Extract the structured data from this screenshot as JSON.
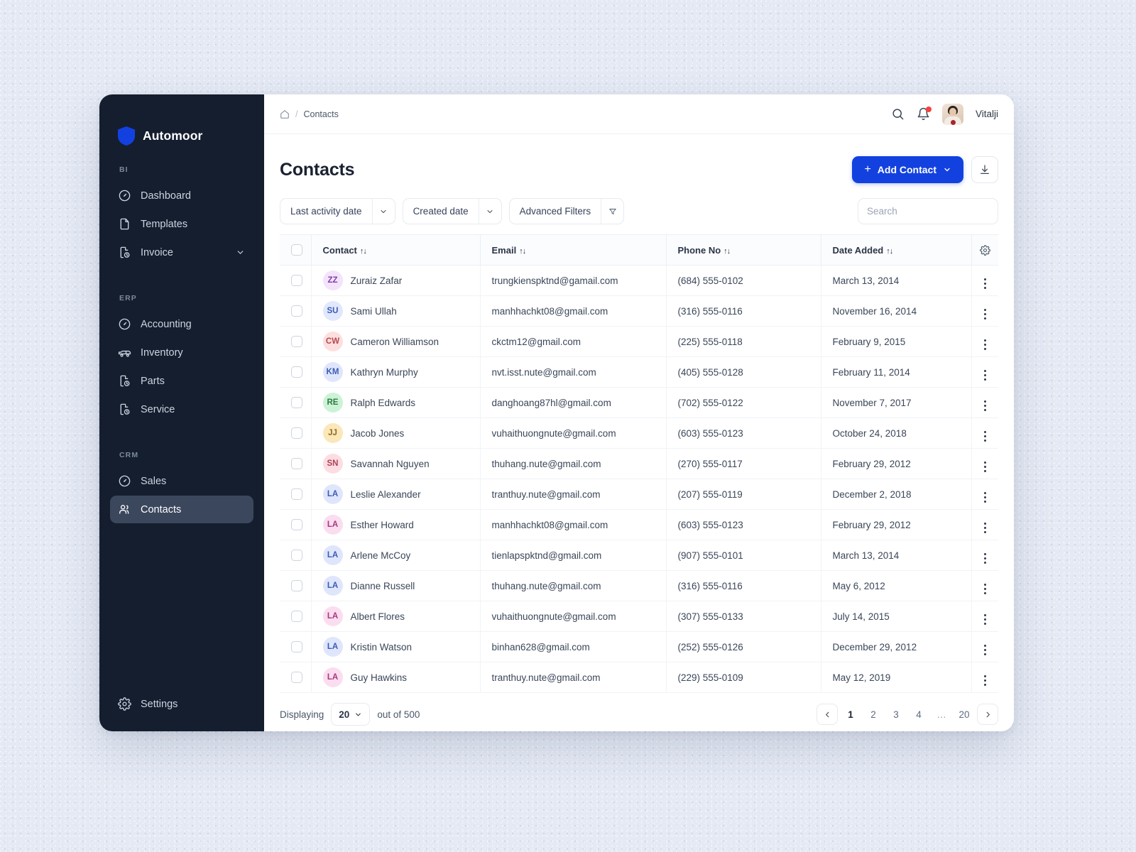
{
  "brand": {
    "name": "Automoor",
    "logo_icon": "shield-icon",
    "color": "#1341e0"
  },
  "sidebar": {
    "groups": [
      {
        "label": "BI",
        "items": [
          {
            "label": "Dashboard",
            "icon": "gauge-icon",
            "active": false,
            "expandable": false
          },
          {
            "label": "Templates",
            "icon": "file-icon",
            "active": false,
            "expandable": false
          },
          {
            "label": "Invoice",
            "icon": "file-clock-icon",
            "active": false,
            "expandable": true
          }
        ]
      },
      {
        "label": "ERP",
        "items": [
          {
            "label": "Accounting",
            "icon": "gauge-icon",
            "active": false,
            "expandable": false
          },
          {
            "label": "Inventory",
            "icon": "truck-icon",
            "active": false,
            "expandable": false
          },
          {
            "label": "Parts",
            "icon": "file-clock-icon",
            "active": false,
            "expandable": false
          },
          {
            "label": "Service",
            "icon": "file-clock-icon",
            "active": false,
            "expandable": false
          }
        ]
      },
      {
        "label": "CRM",
        "items": [
          {
            "label": "Sales",
            "icon": "gauge-icon",
            "active": false,
            "expandable": false
          },
          {
            "label": "Contacts",
            "icon": "users-icon",
            "active": true,
            "expandable": false
          }
        ]
      }
    ],
    "footer": {
      "label": "Settings",
      "icon": "gear-icon"
    }
  },
  "topbar": {
    "breadcrumb": {
      "home_icon": "home-icon",
      "separator": "/",
      "current": "Contacts"
    },
    "search_icon": "search-icon",
    "notification_icon": "bell-icon",
    "user_name": "Vitalji",
    "avatar_icon": "user-avatar"
  },
  "page": {
    "title": "Contacts",
    "add_button": {
      "label": "Add Contact",
      "plus_icon": "plus-icon",
      "chevron_icon": "chevron-down-icon"
    },
    "export_button_icon": "download-icon"
  },
  "toolbar": {
    "filters": [
      {
        "label": "Last activity date",
        "chevron_icon": "chevron-down-icon",
        "split": "chevron"
      },
      {
        "label": "Created date",
        "chevron_icon": "chevron-down-icon",
        "split": "chevron"
      },
      {
        "label": "Advanced Filters",
        "filter_icon": "funnel-icon",
        "split": "funnel"
      }
    ],
    "search": {
      "placeholder": "Search",
      "value": "",
      "icon": "search-icon"
    }
  },
  "table": {
    "columns": [
      {
        "key": "contact",
        "label": "Contact",
        "sortable": true
      },
      {
        "key": "email",
        "label": "Email",
        "sortable": true
      },
      {
        "key": "phone",
        "label": "Phone No",
        "sortable": true
      },
      {
        "key": "date",
        "label": "Date Added",
        "sortable": true
      }
    ],
    "sort_icon": "↑↓",
    "settings_icon": "gear-icon",
    "row_menu_icon": "kebab-menu-icon",
    "select_all_checked": false,
    "rows": [
      {
        "initials": "ZZ",
        "name": "Zuraiz Zafar",
        "email": "trungkienspktnd@gamail.com",
        "phone": "(684) 555-0102",
        "date": "March 13, 2014",
        "bg": "#f3e3fb",
        "fg": "#7d3fa8"
      },
      {
        "initials": "SU",
        "name": "Sami Ullah",
        "email": "manhhachkt08@gmail.com",
        "phone": "(316) 555-0116",
        "date": "November 16, 2014",
        "bg": "#e1e8fd",
        "fg": "#3b5bb5"
      },
      {
        "initials": "CW",
        "name": "Cameron Williamson",
        "email": "ckctm12@gmail.com",
        "phone": "(225) 555-0118",
        "date": "February 9, 2015",
        "bg": "#fddfe0",
        "fg": "#b54a4a"
      },
      {
        "initials": "KM",
        "name": "Kathryn Murphy",
        "email": "nvt.isst.nute@gmail.com",
        "phone": "(405) 555-0128",
        "date": "February 11, 2014",
        "bg": "#dfe6fc",
        "fg": "#3b5bb5"
      },
      {
        "initials": "RE",
        "name": "Ralph Edwards",
        "email": "danghoang87hl@gmail.com",
        "phone": "(702) 555-0122",
        "date": "November 7, 2017",
        "bg": "#ccf3d5",
        "fg": "#2f7a46"
      },
      {
        "initials": "JJ",
        "name": "Jacob Jones",
        "email": "vuhaithuongnute@gmail.com",
        "phone": "(603) 555-0123",
        "date": "October 24, 2018",
        "bg": "#fbe7b8",
        "fg": "#8a6b20"
      },
      {
        "initials": "SN",
        "name": "Savannah Nguyen",
        "email": "thuhang.nute@gmail.com",
        "phone": "(270) 555-0117",
        "date": "February 29, 2012",
        "bg": "#fcdde2",
        "fg": "#b0405a"
      },
      {
        "initials": "LA",
        "name": "Leslie Alexander",
        "email": "tranthuy.nute@gmail.com",
        "phone": "(207) 555-0119",
        "date": "December 2, 2018",
        "bg": "#dfe6fc",
        "fg": "#3b5bb5"
      },
      {
        "initials": "LA",
        "name": "Esther Howard",
        "email": "manhhachkt08@gmail.com",
        "phone": "(603) 555-0123",
        "date": "February 29, 2012",
        "bg": "#fbddf0",
        "fg": "#a8397f"
      },
      {
        "initials": "LA",
        "name": "Arlene McCoy",
        "email": "tienlapspktnd@gmail.com",
        "phone": "(907) 555-0101",
        "date": "March 13, 2014",
        "bg": "#dfe6fc",
        "fg": "#3b5bb5"
      },
      {
        "initials": "LA",
        "name": "Dianne Russell",
        "email": "thuhang.nute@gmail.com",
        "phone": "(316) 555-0116",
        "date": "May 6, 2012",
        "bg": "#dfe6fc",
        "fg": "#3b5bb5"
      },
      {
        "initials": "LA",
        "name": "Albert Flores",
        "email": "vuhaithuongnute@gmail.com",
        "phone": "(307) 555-0133",
        "date": "July 14, 2015",
        "bg": "#fbddf0",
        "fg": "#a8397f"
      },
      {
        "initials": "LA",
        "name": "Kristin Watson",
        "email": "binhan628@gmail.com",
        "phone": "(252) 555-0126",
        "date": "December 29, 2012",
        "bg": "#dfe6fc",
        "fg": "#3b5bb5"
      },
      {
        "initials": "LA",
        "name": "Guy Hawkins",
        "email": "tranthuy.nute@gmail.com",
        "phone": "(229) 555-0109",
        "date": "May 12, 2019",
        "bg": "#fbddf0",
        "fg": "#a8397f"
      }
    ]
  },
  "footer": {
    "displaying_label": "Displaying",
    "page_size": "20",
    "out_of_label": "out of 500",
    "prev_icon": "chevron-left-icon",
    "next_icon": "chevron-right-icon",
    "pages": [
      "1",
      "2",
      "3",
      "4",
      "…",
      "20"
    ],
    "current_page": "1"
  }
}
